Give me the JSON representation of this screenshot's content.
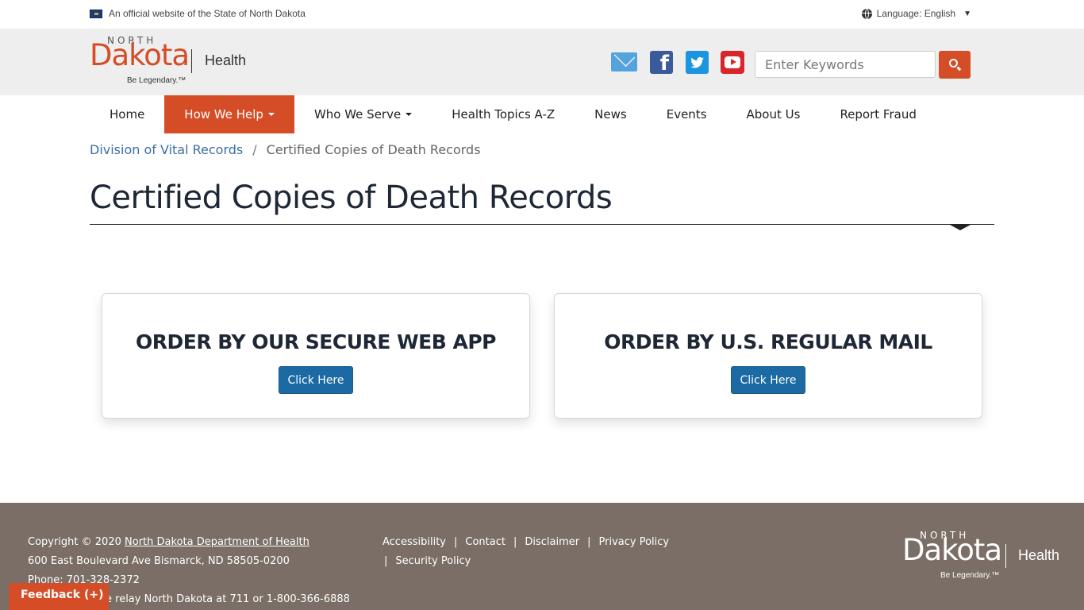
{
  "official_bar": {
    "text": "An official website of the State of North Dakota",
    "language_label": "Language: English"
  },
  "logo": {
    "north": "NORTH",
    "dakota": "Dakota",
    "tagline": "Be Legendary.™",
    "health": "Health"
  },
  "header": {
    "social": [
      "email-icon",
      "facebook-icon",
      "twitter-icon",
      "youtube-icon"
    ],
    "search": {
      "placeholder": "Enter Keywords",
      "value": ""
    }
  },
  "nav": {
    "items": [
      {
        "label": "Home",
        "dropdown": false
      },
      {
        "label": "How We Help",
        "dropdown": true
      },
      {
        "label": "Who We Serve",
        "dropdown": true
      },
      {
        "label": "Health Topics A-Z",
        "dropdown": false
      },
      {
        "label": "News",
        "dropdown": false
      },
      {
        "label": "Events",
        "dropdown": false
      },
      {
        "label": "About Us",
        "dropdown": false
      },
      {
        "label": "Report Fraud",
        "dropdown": false
      }
    ],
    "active_index": 1
  },
  "breadcrumb": {
    "parent": "Division of Vital Records",
    "separator": "/",
    "current": "Certified Copies of Death Records"
  },
  "page": {
    "title": "Certified Copies of Death Records"
  },
  "cards": [
    {
      "title": "ORDER BY OUR SECURE WEB APP",
      "button": "Click Here"
    },
    {
      "title": "ORDER BY U.S. REGULAR MAIL",
      "button": "Click Here"
    }
  ],
  "footer": {
    "copyright_prefix": "Copyright © 2020",
    "org_link": "North Dakota Department of Health",
    "address": "600 East Boulevard Ave Bismarck, ND 58505-0200",
    "phone": "Phone: 701-328-2372",
    "relay": "e relay North Dakota at 711 or 1-800-366-6888",
    "links": [
      "Accessibility",
      "Contact",
      "Disclaimer",
      "Privacy Policy",
      "Security Policy"
    ],
    "link_separator": "|"
  },
  "feedback": {
    "label": "Feedback (+)"
  },
  "colors": {
    "brand_orange": "#d44d27",
    "header_gray": "#eeeeee",
    "button_blue": "#1c6aa3",
    "footer_brown": "#7a6e66",
    "link_blue": "#3a6ea5"
  }
}
